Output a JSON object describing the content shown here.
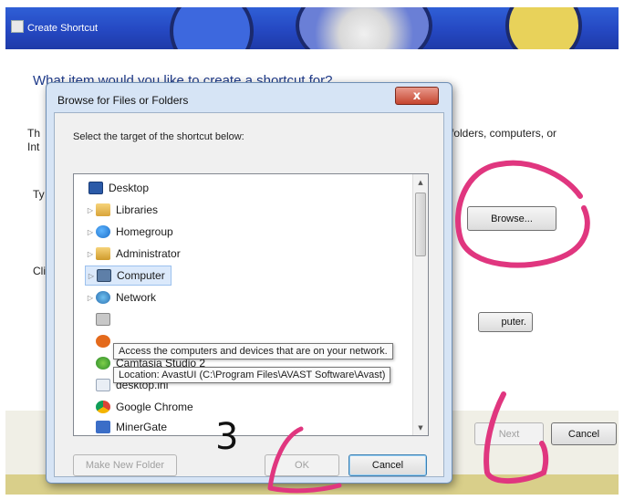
{
  "wizard": {
    "title": "Create Shortcut",
    "question": "What item would you like to create a shortcut for?",
    "description_left": "Th",
    "description_left2": "Int",
    "description_right": "folders, computers, or",
    "type_label_fragment": "Ty",
    "click_label_fragment": "Cli",
    "browse_label": "Browse...",
    "computer_label": "puter.",
    "next_label": "Next",
    "cancel_label": "Cancel"
  },
  "dialog": {
    "title": "Browse for Files or Folders",
    "close_glyph": "x",
    "prompt": "Select the target of the shortcut below:",
    "tree": [
      {
        "label": "Desktop",
        "icon": "desktop-icon",
        "arrow": ""
      },
      {
        "label": "Libraries",
        "icon": "libraries-icon",
        "arrow": "▷"
      },
      {
        "label": "Homegroup",
        "icon": "homegroup-icon",
        "arrow": "▷"
      },
      {
        "label": "Administrator",
        "icon": "user-folder-icon",
        "arrow": "▷"
      },
      {
        "label": "Computer",
        "icon": "computer-icon",
        "arrow": "▷",
        "selected": true
      },
      {
        "label": "Network",
        "icon": "network-icon",
        "arrow": "▷"
      },
      {
        "label": "",
        "icon": "shortcut-icon",
        "arrow": ""
      },
      {
        "label": "",
        "icon": "avast-icon",
        "arrow": ""
      },
      {
        "label": "Camtasia Studio 2",
        "icon": "camtasia-icon",
        "arrow": ""
      },
      {
        "label": "desktop.ini",
        "icon": "ini-file-icon",
        "arrow": ""
      },
      {
        "label": "Google Chrome",
        "icon": "chrome-icon",
        "arrow": ""
      },
      {
        "label": "MinerGate",
        "icon": "minergate-icon",
        "arrow": ""
      }
    ],
    "tooltip_network": "Access the computers and devices that are on your network.",
    "tooltip_location": "Location: AvastUI (C:\\Program Files\\AVAST Software\\Avast)",
    "make_new_folder_label": "Make New Folder",
    "ok_label": "OK",
    "cancel_label": "Cancel"
  },
  "annotation": {
    "step_number": "3",
    "color": "#e0367f"
  }
}
